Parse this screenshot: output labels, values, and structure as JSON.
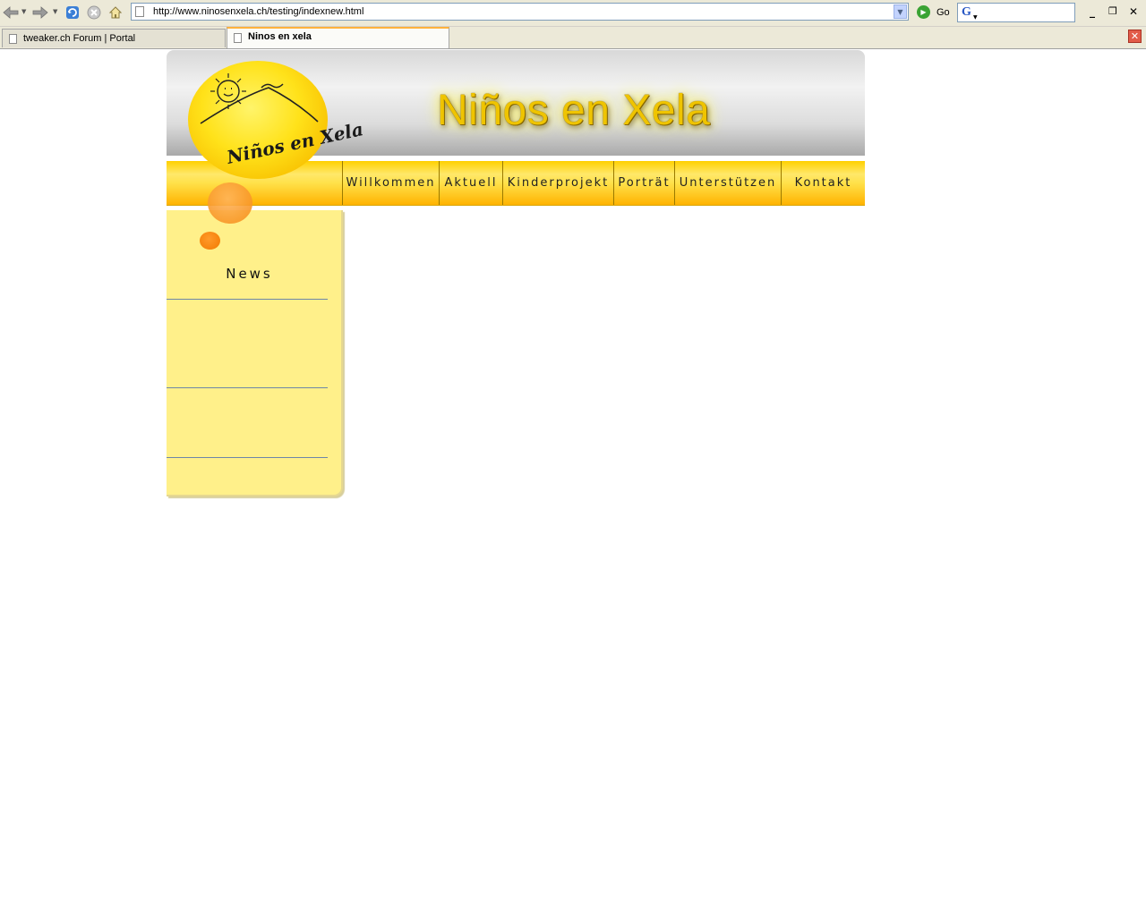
{
  "browser": {
    "url": "http://www.ninosenxela.ch/testing/indexnew.html",
    "go_label": "Go",
    "search_logo": "G",
    "tabs": [
      {
        "label": "tweaker.ch Forum | Portal",
        "active": false
      },
      {
        "label": "Ninos en xela",
        "active": true
      }
    ],
    "icons": [
      "back-icon",
      "forward-icon",
      "refresh-icon",
      "stop-icon",
      "home-icon",
      "go-icon",
      "minimize-icon",
      "restore-icon",
      "close-icon",
      "close-tab-icon"
    ]
  },
  "site": {
    "title": "Niños en Xela",
    "logo_text": "Niños en Xela",
    "nav": [
      "Willkommen",
      "Aktuell",
      "Kinderprojekt",
      "Porträt",
      "Unterstützen",
      "Kontakt"
    ],
    "sidebar": {
      "heading": "News"
    }
  },
  "colors": {
    "accent_yellow": "#ffe14a",
    "sidebar_bg": "#fff08a",
    "bubble_orange": "#f58a12",
    "tab_highlight": "#ffb23d"
  }
}
